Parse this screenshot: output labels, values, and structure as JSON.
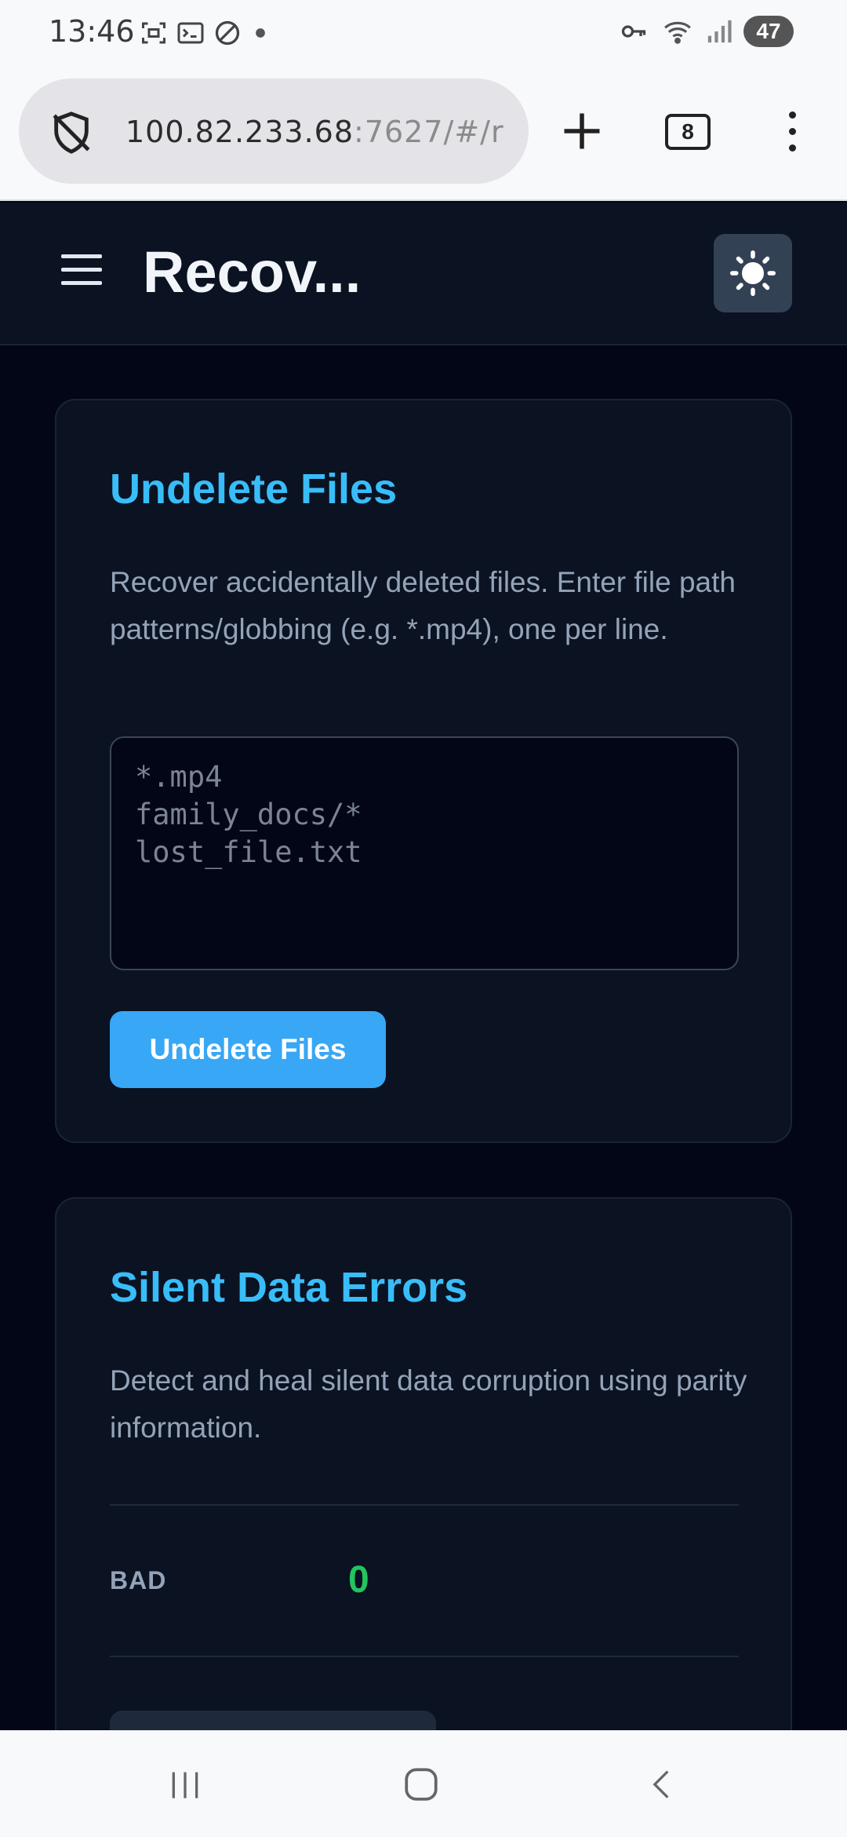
{
  "status_bar": {
    "time": "13:46",
    "battery": "47",
    "left_icons": [
      "screenshot-icon",
      "terminal-icon",
      "do-not-disturb-icon",
      "dot-icon"
    ],
    "right_icons": [
      "key-icon",
      "wifi-icon",
      "signal-icon",
      "battery-icon"
    ]
  },
  "browser": {
    "url_host": "100.82.233.68",
    "url_path": ":7627/#/r",
    "tab_count": "8",
    "icons": [
      "shield-off-icon",
      "plus-icon",
      "tabs-icon",
      "more-vertical-icon"
    ]
  },
  "header": {
    "title": "Recov...",
    "icons": [
      "hamburger-icon",
      "sun-icon"
    ]
  },
  "undelete": {
    "title": "Undelete Files",
    "description": "Recover accidentally deleted files. Enter file path patterns/globbing (e.g. *.mp4), one per line.",
    "placeholder": "*.mp4\nfamily_docs/*\nlost_file.txt",
    "value": "",
    "button_label": "Undelete Files"
  },
  "silent_errors": {
    "title": "Silent Data Errors",
    "description": "Detect and heal silent data corruption using parity information.",
    "stat_label": "BAD",
    "stat_value": "0",
    "colors": {
      "ok": "#22c55e"
    }
  },
  "colors": {
    "accent": "#38bdf8",
    "button": "#38a7f5",
    "background": "#020617",
    "card": "#0b1222"
  }
}
